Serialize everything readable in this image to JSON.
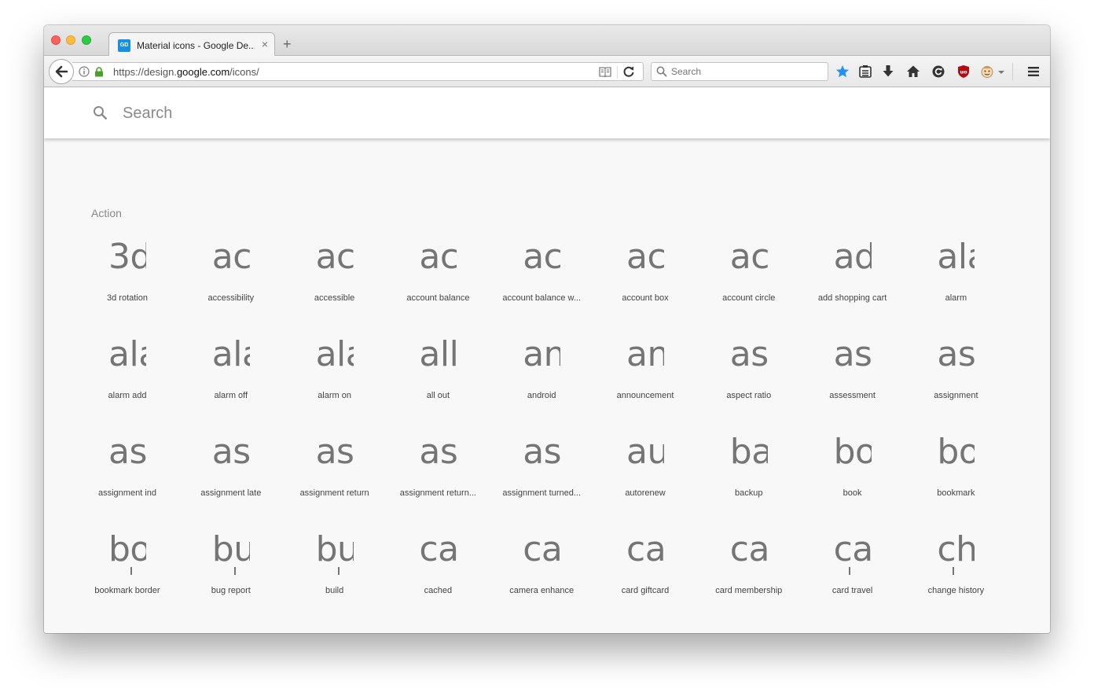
{
  "browser": {
    "tab": {
      "favicon_text": "GD",
      "title": "Material icons - Google De...",
      "close": "×"
    },
    "new_tab": "+",
    "url": {
      "scheme": "https://design.",
      "host": "google.com",
      "path": "/icons/"
    },
    "search_placeholder": "Search",
    "colors": {
      "accent_blue": "#2a90f0",
      "ublock_red": "#b00d13"
    }
  },
  "page": {
    "search_placeholder": "Search",
    "section": "Action",
    "icons": [
      {
        "glyph": "3d",
        "label": "3d rotation"
      },
      {
        "glyph": "ac",
        "label": "accessibility"
      },
      {
        "glyph": "ac",
        "label": "accessible"
      },
      {
        "glyph": "ac",
        "label": "account balance"
      },
      {
        "glyph": "ac",
        "label": "account balance w..."
      },
      {
        "glyph": "ac",
        "label": "account box"
      },
      {
        "glyph": "ac",
        "label": "account circle"
      },
      {
        "glyph": "ad",
        "label": "add shopping cart"
      },
      {
        "glyph": "ala",
        "label": "alarm"
      },
      {
        "glyph": "ala",
        "label": "alarm add"
      },
      {
        "glyph": "ala",
        "label": "alarm off"
      },
      {
        "glyph": "ala",
        "label": "alarm on"
      },
      {
        "glyph": "all",
        "label": "all out"
      },
      {
        "glyph": "an",
        "label": "android"
      },
      {
        "glyph": "an",
        "label": "announcement"
      },
      {
        "glyph": "as",
        "label": "aspect ratio"
      },
      {
        "glyph": "as",
        "label": "assessment"
      },
      {
        "glyph": "as",
        "label": "assignment"
      },
      {
        "glyph": "as",
        "label": "assignment ind"
      },
      {
        "glyph": "as",
        "label": "assignment late"
      },
      {
        "glyph": "as",
        "label": "assignment return"
      },
      {
        "glyph": "as",
        "label": "assignment return..."
      },
      {
        "glyph": "as",
        "label": "assignment turned..."
      },
      {
        "glyph": "au",
        "label": "autorenew"
      },
      {
        "glyph": "ba",
        "label": "backup"
      },
      {
        "glyph": "bo",
        "label": "book"
      },
      {
        "glyph": "bo",
        "label": "bookmark"
      },
      {
        "glyph": "bo",
        "label": "bookmark border"
      },
      {
        "glyph": "bu",
        "label": "bug report"
      },
      {
        "glyph": "bu",
        "label": "build"
      },
      {
        "glyph": "ca",
        "label": "cached"
      },
      {
        "glyph": "ca",
        "label": "camera enhance"
      },
      {
        "glyph": "ca",
        "label": "card giftcard"
      },
      {
        "glyph": "ca",
        "label": "card membership"
      },
      {
        "glyph": "ca",
        "label": "card travel"
      },
      {
        "glyph": "ch",
        "label": "change history"
      }
    ]
  }
}
